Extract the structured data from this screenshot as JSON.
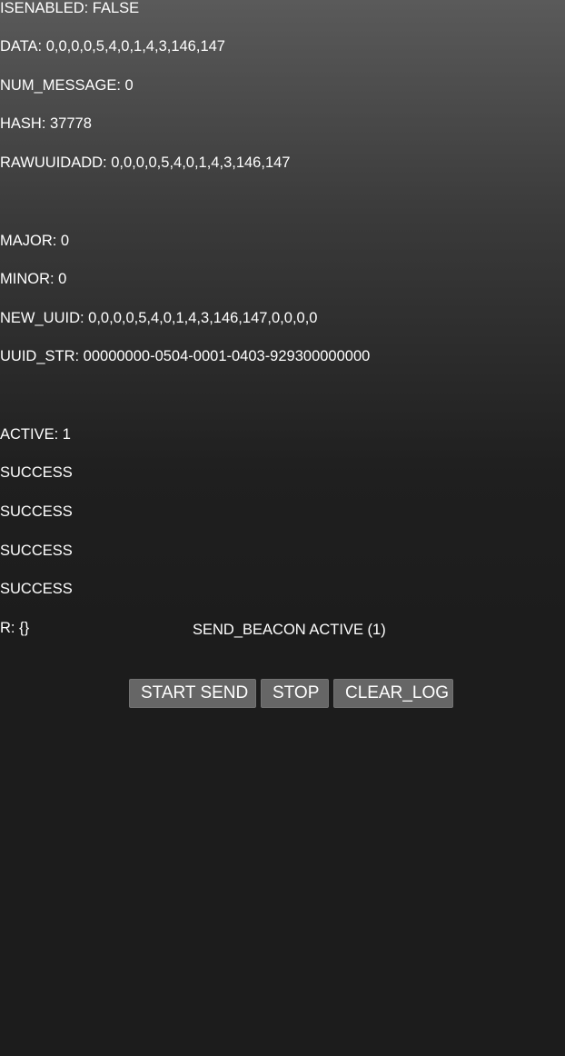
{
  "log": {
    "lines": [
      "ISENABLED: FALSE",
      "DATA: 0,0,0,0,5,4,0,1,4,3,146,147",
      "NUM_MESSAGE: 0",
      "HASH: 37778",
      "RAWUUIDADD: 0,0,0,0,5,4,0,1,4,3,146,147",
      "MAJOR: 0",
      "MINOR: 0",
      "NEW_UUID: 0,0,0,0,5,4,0,1,4,3,146,147,0,0,0,0",
      "UUID_STR: 00000000-0504-0001-0403-929300000000",
      "ACTIVE: 1",
      "SUCCESS",
      "SUCCESS",
      "SUCCESS",
      "SUCCESS",
      "R: {}"
    ]
  },
  "status": {
    "text": "SEND_BEACON ACTIVE (1)"
  },
  "buttons": {
    "start_label": "START SEND",
    "stop_label": "STOP",
    "clear_label": "CLEAR_LOG"
  },
  "colors": {
    "button_bg": "#666666",
    "text": "#ffffff",
    "background_top": "#5a5a5a",
    "background_bottom": "#1c1c1c"
  }
}
